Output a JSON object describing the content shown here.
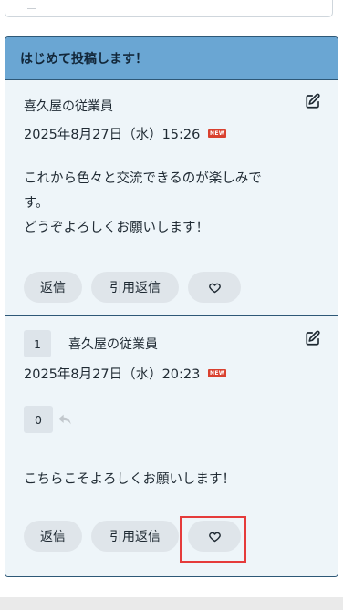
{
  "thread": {
    "title": "はじめて投稿します！",
    "posts": [
      {
        "author": "喜久屋の従業員",
        "datetime": "2025年8月27日（水）15:26",
        "badge": "NEW",
        "body_lines": [
          "これから色々と交流できるのが楽しみで",
          "す。",
          "どうぞよろしくお願いします！"
        ],
        "reply_label": "返信",
        "quote_reply_label": "引用返信"
      },
      {
        "number": "1",
        "author": "喜久屋の従業員",
        "datetime": "2025年8月27日（水）20:23",
        "badge": "NEW",
        "reply_count": "0",
        "body_lines": [
          "こちらこそよろしくお願いします！"
        ],
        "reply_label": "返信",
        "quote_reply_label": "引用返信"
      }
    ]
  },
  "icons": {
    "edit": "edit-pencil-icon",
    "like": "heart-icon",
    "reply_arrow": "reply-arrow-icon"
  },
  "colors": {
    "header_bg": "#6aa6d3",
    "border": "#2e5877",
    "post_bg": "#eef5f9",
    "pill_bg": "#dfe5ea",
    "new_badge": "#d9412f",
    "highlight": "#e53b3b"
  }
}
